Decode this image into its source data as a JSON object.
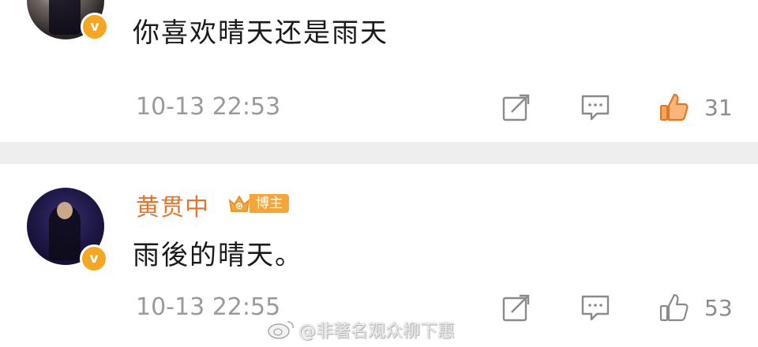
{
  "comments": [
    {
      "text": "你喜欢晴天还是雨天",
      "time": "10-13 22:53",
      "likes": "31",
      "liked": true
    },
    {
      "author": "黄贯中",
      "badge": "博主",
      "text": "雨後的晴天。",
      "time": "10-13 22:55",
      "likes": "53",
      "liked": false
    }
  ],
  "verified_mark": "v",
  "watermark": "@非著名观众柳下惠",
  "colors": {
    "accent": "#e8742a",
    "badge": "#f6a53a",
    "like_active": "#ef8a3c",
    "icon_gray": "#8a8a8a",
    "divider": "#eeeeee"
  },
  "icons": [
    "share-icon",
    "comment-icon",
    "thumbs-up-icon",
    "verified-icon",
    "crown-icon",
    "weibo-logo-icon"
  ]
}
